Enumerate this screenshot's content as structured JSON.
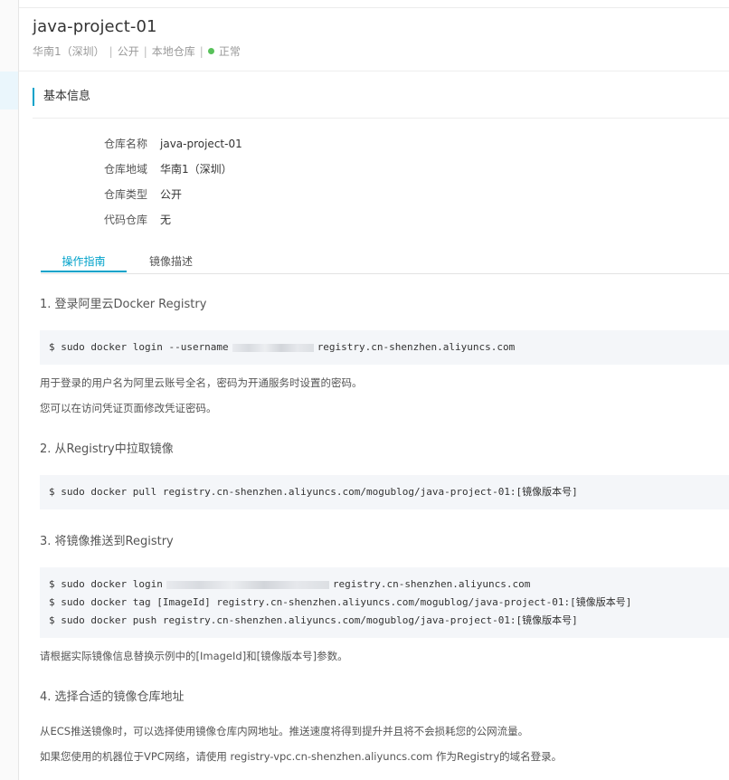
{
  "header": {
    "title": "java-project-01",
    "region": "华南1（深圳）",
    "visibility": "公开",
    "repo_kind": "本地仓库",
    "status": "正常"
  },
  "colors": {
    "accent": "#00a2ca",
    "status_ok": "#58c15a",
    "code_bg": "#f4f6f9"
  },
  "basic_info": {
    "title": "基本信息",
    "rows": [
      {
        "label": "仓库名称",
        "value": "java-project-01"
      },
      {
        "label": "仓库地域",
        "value": "华南1（深圳）"
      },
      {
        "label": "仓库类型",
        "value": "公开"
      },
      {
        "label": "代码仓库",
        "value": "无"
      }
    ]
  },
  "tabs": {
    "guide": "操作指南",
    "description": "镜像描述"
  },
  "steps": {
    "s1": {
      "title": "1. 登录阿里云Docker Registry",
      "code_prefix": "$ sudo docker login --username",
      "code_suffix": "registry.cn-shenzhen.aliyuncs.com",
      "note1": "用于登录的用户名为阿里云账号全名，密码为开通服务时设置的密码。",
      "note2": "您可以在访问凭证页面修改凭证密码。"
    },
    "s2": {
      "title": "2. 从Registry中拉取镜像",
      "code": "$ sudo docker pull registry.cn-shenzhen.aliyuncs.com/mogublog/java-project-01:[镜像版本号]"
    },
    "s3": {
      "title": "3. 将镜像推送到Registry",
      "code_login_prefix": "$ sudo docker login",
      "code_login_suffix": "registry.cn-shenzhen.aliyuncs.com",
      "code_tag": "$ sudo docker tag [ImageId] registry.cn-shenzhen.aliyuncs.com/mogublog/java-project-01:[镜像版本号]",
      "code_push": "$ sudo docker push registry.cn-shenzhen.aliyuncs.com/mogublog/java-project-01:[镜像版本号]",
      "note": "请根据实际镜像信息替换示例中的[ImageId]和[镜像版本号]参数。"
    },
    "s4": {
      "title": "4. 选择合适的镜像仓库地址",
      "note1": "从ECS推送镜像时，可以选择使用镜像仓库内网地址。推送速度将得到提升并且将不会损耗您的公网流量。",
      "note2": "如果您使用的机器位于VPC网络，请使用 registry-vpc.cn-shenzhen.aliyuncs.com 作为Registry的域名登录。"
    }
  }
}
